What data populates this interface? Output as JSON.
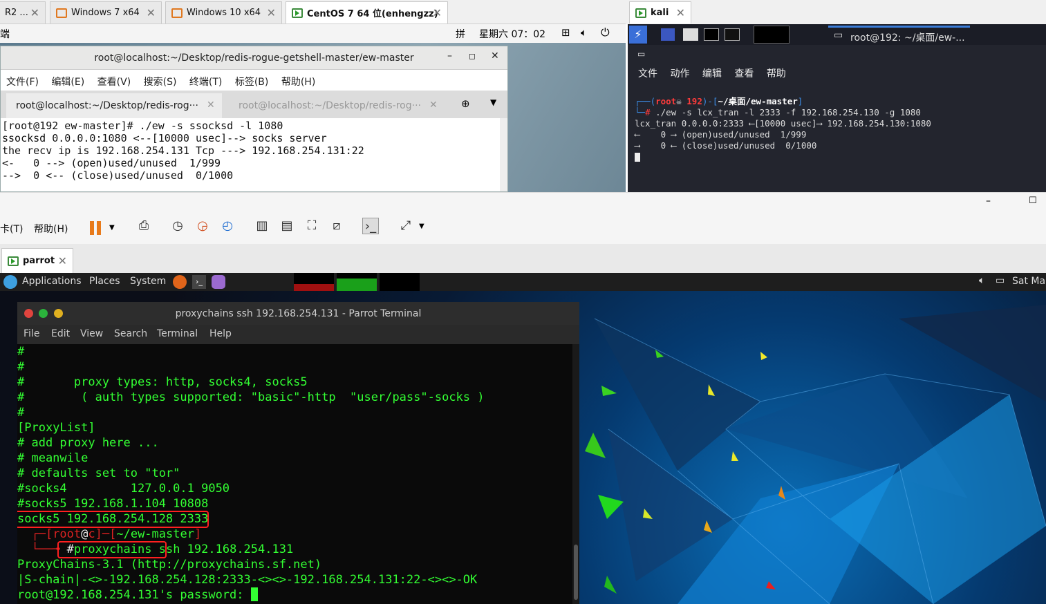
{
  "vmware_top_tabs": [
    {
      "label": "R2 ...",
      "active": false
    },
    {
      "label": "Windows 7 x64",
      "active": false
    },
    {
      "label": "Windows 10 x64",
      "active": false
    },
    {
      "label": "CentOS 7 64 位(enhengzz)",
      "active": true
    }
  ],
  "centos": {
    "topbar_left": "端",
    "ime": "拼",
    "clock": "星期六 07：02",
    "window_title": "root@localhost:~/Desktop/redis-rogue-getshell-master/ew-master",
    "menu": [
      "文件(F)",
      "编辑(E)",
      "查看(V)",
      "搜索(S)",
      "终端(T)",
      "标签(B)",
      "帮助(H)"
    ],
    "tabs": [
      "root@localhost:~/Desktop/redis-rog···",
      "root@localhost:~/Desktop/redis-rog···"
    ],
    "terminal_lines": [
      "[root@192 ew-master]# ./ew -s ssocksd -l 1080",
      "ssocksd 0.0.0.0:1080 <--[10000 usec]--> socks server",
      "the recv ip is 192.168.254.131 Tcp ---> 192.168.254.131:22",
      "<-   0 --> (open)used/unused  1/999",
      "-->  0 <-- (close)used/unused  0/1000"
    ]
  },
  "kali": {
    "tab_label": "kali",
    "taskbar_item": "root@192: ~/桌面/ew-...",
    "menu": [
      "文件",
      "动作",
      "编辑",
      "查看",
      "帮助"
    ],
    "prompt_user": "root",
    "prompt_host": "192",
    "prompt_path": "~/桌面/ew-master",
    "command": "./ew -s lcx_tran -l 2333 -f 192.168.254.130 -g 1080",
    "output_lines": [
      "lcx_tran 0.0.0.0:2333 ⟵[10000 usec]⟶ 192.168.254.130:1080",
      "⟵    0 ⟶ (open)used/unused  1/999",
      "⟶    0 ⟵ (close)used/unused  0/1000"
    ]
  },
  "vm_toolbar": {
    "menu_left": "卡(T)",
    "help": "帮助(H)"
  },
  "parrot_tab": "parrot",
  "parrot_panel": {
    "items": [
      "Applications",
      "Places",
      "System"
    ],
    "clock": "Sat Mar"
  },
  "terminal": {
    "title": "proxychains ssh 192.168.254.131 - Parrot Terminal",
    "menu": [
      "File",
      "Edit",
      "View",
      "Search",
      "Terminal",
      "Help"
    ],
    "lines": [
      "#",
      "#",
      "#       proxy types: http, socks4, socks5",
      "#        ( auth types supported: \"basic\"-http  \"user/pass\"-socks )",
      "#",
      "[ProxyList]",
      "# add proxy here ...",
      "# meanwile",
      "# defaults set to \"tor\"",
      "#socks4         127.0.0.1 9050",
      "#socks5 192.168.1.104 10808",
      "socks5 192.168.254.128 2333"
    ],
    "prompt_user": "root",
    "prompt_at": "@",
    "prompt_host": "c",
    "prompt_path": "~/ew-master",
    "cmd_highlight": "proxychains ssh",
    "cmd_rest": " 192.168.254.131",
    "output": [
      "ProxyChains-3.1 (http://proxychains.sf.net)",
      "|S-chain|-<>-192.168.254.128:2333-<><>-192.168.254.131:22-<><>-OK",
      "root@192.168.254.131's password: "
    ]
  }
}
